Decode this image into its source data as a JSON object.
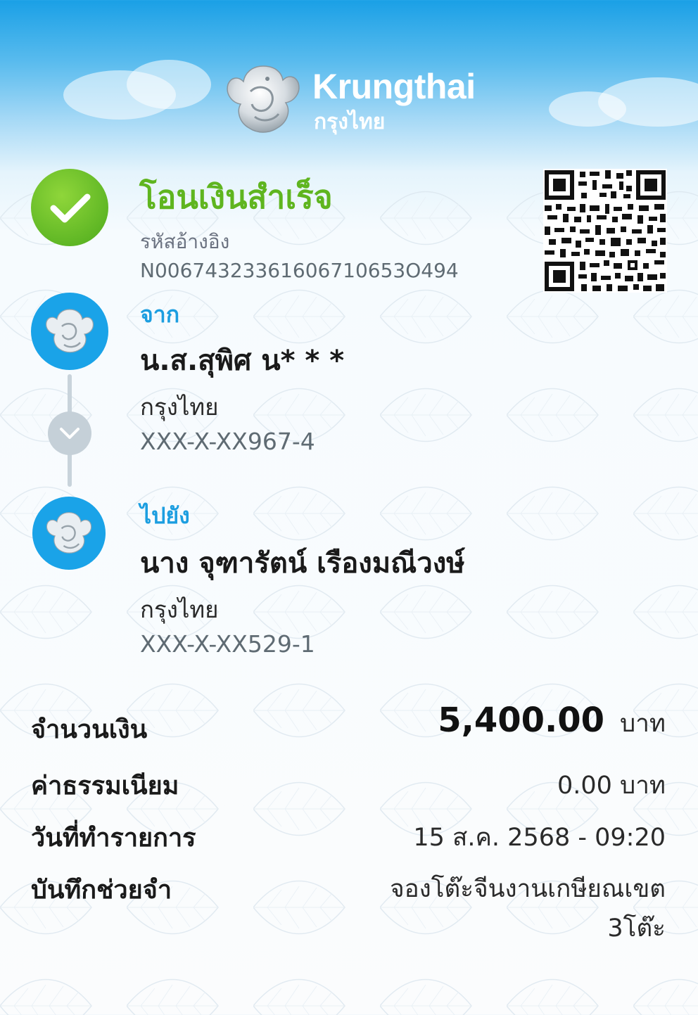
{
  "brand": {
    "name": "Krungthai",
    "name_thai": "กรุงไทย"
  },
  "status": {
    "title": "โอนเงินสำเร็จ",
    "ref_label": "รหัสอ้างอิง",
    "ref_value": "N00674323361606710653O494"
  },
  "from": {
    "label": "จาก",
    "name": "น.ส.สุพิศ น* * *",
    "bank": "กรุงไทย",
    "account": "XXX-X-XX967-4"
  },
  "to": {
    "label": "ไปยัง",
    "name": "นาง จุฑารัตน์ เรืองมณีวงษ์",
    "bank": "กรุงไทย",
    "account": "XXX-X-XX529-1"
  },
  "details": {
    "amount_label": "จำนวนเงิน",
    "amount_value": "5,400.00",
    "amount_unit": "บาท",
    "fee_label": "ค่าธรรมเนียม",
    "fee_value": "0.00 บาท",
    "date_label": "วันที่ทำรายการ",
    "date_value": "15 ส.ค. 2568 - 09:20",
    "memo_label": "บันทึกช่วยจำ",
    "memo_value": "จองโต๊ะจีนงานเกษียณเขต 3โต๊ะ"
  },
  "icons": {
    "success": "check-icon",
    "bank_logo": "krungthai-bird-icon",
    "timeline": "chevron-down-icon",
    "qr": "qr-code-icon"
  },
  "colors": {
    "brand_blue": "#1aa3e8",
    "success_green": "#5fb51f",
    "accent_label": "#1c9ee0"
  }
}
